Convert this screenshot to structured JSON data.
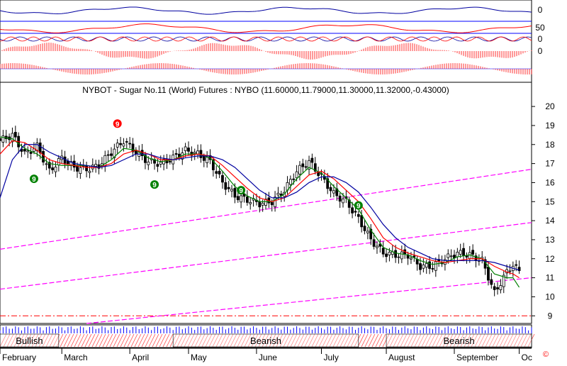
{
  "chart_data": {
    "type": "line",
    "title": "NYBOT - Sugar No.11 (World) Futures : NYBO (11.60000,11.79000,11.30000,11.32000,-0.43000)",
    "xlabel": "",
    "ylabel": "",
    "ylim": [
      8.6,
      20.6
    ],
    "y_ticks": [
      9,
      10,
      11,
      12,
      13,
      14,
      15,
      16,
      17,
      18,
      19,
      20
    ],
    "grid": false,
    "months": [
      {
        "label": "February",
        "start": 0
      },
      {
        "label": "March",
        "start": 20
      },
      {
        "label": "April",
        "start": 42
      },
      {
        "label": "May",
        "start": 61
      },
      {
        "label": "June",
        "start": 83
      },
      {
        "label": "July",
        "start": 104
      },
      {
        "label": "August",
        "start": 125
      },
      {
        "label": "September",
        "start": 147
      },
      {
        "label": "Oc",
        "start": 168
      }
    ],
    "sample_days": [
      0,
      4,
      8,
      12,
      16,
      20,
      24,
      28,
      32,
      36,
      40,
      44,
      48,
      52,
      56,
      60,
      64,
      68,
      72,
      76,
      80,
      84,
      88,
      92,
      96,
      100,
      104,
      108,
      112,
      116,
      120,
      124,
      128,
      132,
      136,
      140,
      144,
      148,
      152,
      156,
      160,
      164,
      166,
      168
    ],
    "close": [
      18.2,
      18.5,
      17.5,
      17.9,
      16.6,
      17.3,
      16.8,
      16.7,
      16.9,
      17.6,
      18.2,
      17.6,
      17.1,
      17.0,
      17.3,
      17.7,
      17.5,
      17.1,
      16.0,
      15.3,
      15.1,
      14.9,
      15.0,
      15.6,
      16.6,
      17.1,
      16.3,
      15.4,
      15.0,
      14.1,
      13.0,
      12.3,
      12.2,
      12.2,
      11.6,
      11.6,
      12.0,
      12.3,
      12.2,
      11.9,
      10.2,
      11.3,
      11.7,
      11.32
    ],
    "series": [
      {
        "name": "",
        "color": "#008000",
        "values": [
          18.4,
          18.3,
          17.8,
          17.5,
          17.0,
          16.9,
          16.9,
          16.9,
          16.8,
          17.2,
          17.8,
          17.7,
          17.3,
          17.1,
          17.2,
          17.5,
          17.5,
          17.3,
          16.6,
          15.8,
          15.3,
          15.0,
          15.0,
          15.4,
          16.2,
          16.8,
          16.5,
          15.8,
          15.2,
          14.6,
          13.5,
          12.6,
          12.3,
          12.2,
          11.9,
          11.7,
          11.8,
          12.1,
          12.2,
          12.0,
          11.2,
          11.0,
          11.0,
          10.5
        ]
      },
      {
        "name": "",
        "color": "#ff0000",
        "values": [
          17.5,
          18.2,
          18.1,
          17.7,
          17.2,
          17.0,
          16.9,
          16.8,
          16.8,
          17.0,
          17.5,
          17.7,
          17.5,
          17.2,
          17.2,
          17.4,
          17.5,
          17.4,
          16.9,
          16.3,
          15.7,
          15.2,
          15.0,
          15.2,
          15.8,
          16.4,
          16.6,
          16.2,
          15.6,
          15.0,
          14.1,
          13.1,
          12.6,
          12.3,
          12.1,
          11.9,
          11.8,
          11.9,
          12.0,
          12.0,
          11.6,
          11.3,
          11.2,
          11.0
        ]
      },
      {
        "name": "",
        "color": "#0000a0",
        "values": [
          15.2,
          17.2,
          18.0,
          18.0,
          17.6,
          17.3,
          17.0,
          16.9,
          16.8,
          16.9,
          17.2,
          17.5,
          17.5,
          17.3,
          17.2,
          17.3,
          17.4,
          17.4,
          17.2,
          16.8,
          16.2,
          15.6,
          15.2,
          15.2,
          15.5,
          16.0,
          16.3,
          16.3,
          16.0,
          15.5,
          14.7,
          13.8,
          13.1,
          12.6,
          12.3,
          12.0,
          11.9,
          11.9,
          11.9,
          11.9,
          11.8,
          11.6,
          11.5,
          11.4
        ]
      }
    ],
    "trendlines": [
      {
        "color": "#ff00ff",
        "from": [
          0,
          12.5
        ],
        "to": [
          172,
          16.7
        ]
      },
      {
        "color": "#ff00ff",
        "from": [
          0,
          10.4
        ],
        "to": [
          172,
          13.9
        ]
      },
      {
        "color": "#ff00ff",
        "from": [
          28,
          8.6
        ],
        "to": [
          172,
          11.0
        ]
      }
    ],
    "support_line": {
      "color": "#ff0000",
      "value": 9.0,
      "style": "dash-dot"
    },
    "markers": [
      {
        "label": "9",
        "day": 11,
        "price": 16.2,
        "color": "#008000"
      },
      {
        "label": "9",
        "day": 38,
        "price": 19.1,
        "color": "#ff0000"
      },
      {
        "label": "9",
        "day": 50,
        "price": 15.9,
        "color": "#008000"
      },
      {
        "label": "9",
        "day": 78,
        "price": 15.6,
        "color": "#008000"
      },
      {
        "label": "9",
        "day": 116,
        "price": 14.8,
        "color": "#008000"
      }
    ],
    "indicator_panel": {
      "labels": [
        {
          "text": "0",
          "value": 0
        },
        {
          "text": "50",
          "value": 50
        },
        {
          "text": "0",
          "value": 0
        },
        {
          "text": "0",
          "value": 0
        }
      ]
    },
    "sentiment_bar": [
      {
        "label": "Bullish",
        "from": 0,
        "to": 19
      },
      {
        "label": "Bearish",
        "from": 56,
        "to": 116
      },
      {
        "label": "Bearish",
        "from": 125,
        "to": 172
      }
    ],
    "corner_icon": "copyright-icon"
  }
}
